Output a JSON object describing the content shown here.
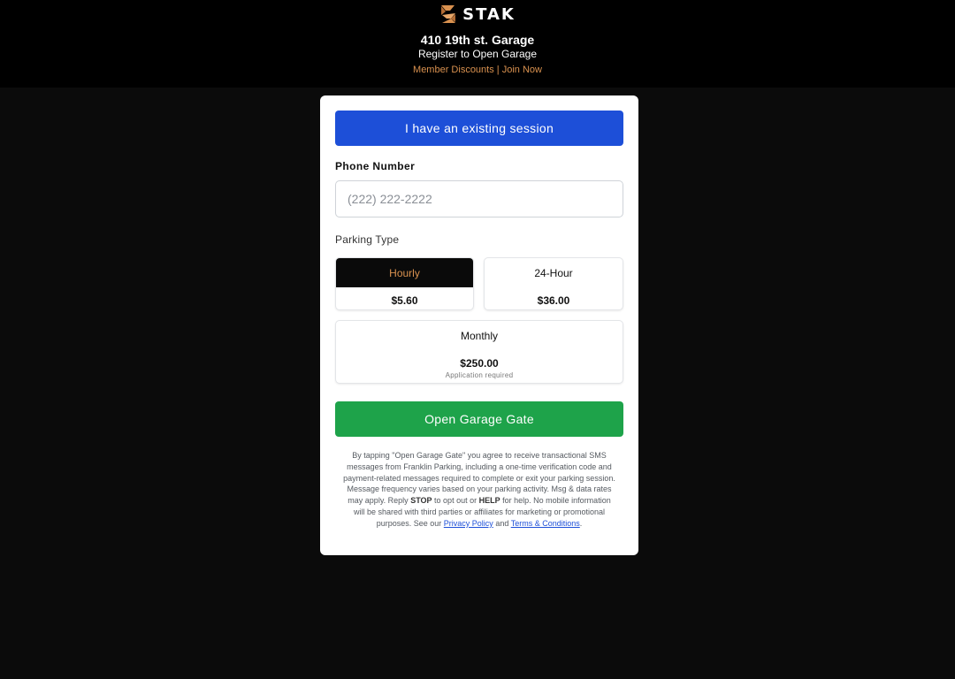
{
  "brand": {
    "name": "STAK",
    "logo_icon": "stak-logo-icon",
    "accent": "#d9914f"
  },
  "header": {
    "title": "410 19th st. Garage",
    "subtitle": "Register to Open Garage",
    "member_discounts": "Member Discounts",
    "separator": "|",
    "join_now": "Join Now"
  },
  "form": {
    "existing_session_label": "I have an existing session",
    "phone_label": "Phone Number",
    "phone_placeholder": "(222) 222-2222",
    "phone_value": "",
    "parking_type_label": "Parking Type",
    "options": [
      {
        "name": "Hourly",
        "price": "$5.60",
        "selected": true
      },
      {
        "name": "24-Hour",
        "price": "$36.00",
        "selected": false
      },
      {
        "name": "Monthly",
        "price": "$250.00",
        "note": "Application required",
        "selected": false
      }
    ],
    "open_gate_label": "Open Garage Gate"
  },
  "legal": {
    "text_1": "By tapping \"Open Garage Gate\" you agree to receive transactional SMS messages from Franklin Parking, including a one-time verification code and payment-related messages required to complete or exit your parking session. Message frequency varies based on your parking activity. Msg & data rates may apply. Reply",
    "stop": "STOP",
    "text_2": "to opt out or",
    "help": "HELP",
    "text_3": "for help. No mobile information will be shared with third parties or affiliates for marketing or promotional purposes. See our",
    "privacy_link": "Privacy Policy",
    "and": "and",
    "terms_link": "Terms & Conditions",
    "end": "."
  },
  "colors": {
    "primary_blue": "#1d4fd8",
    "success_green": "#1ea34a",
    "header_bg": "#000000",
    "page_bg": "#0b0b0b"
  }
}
